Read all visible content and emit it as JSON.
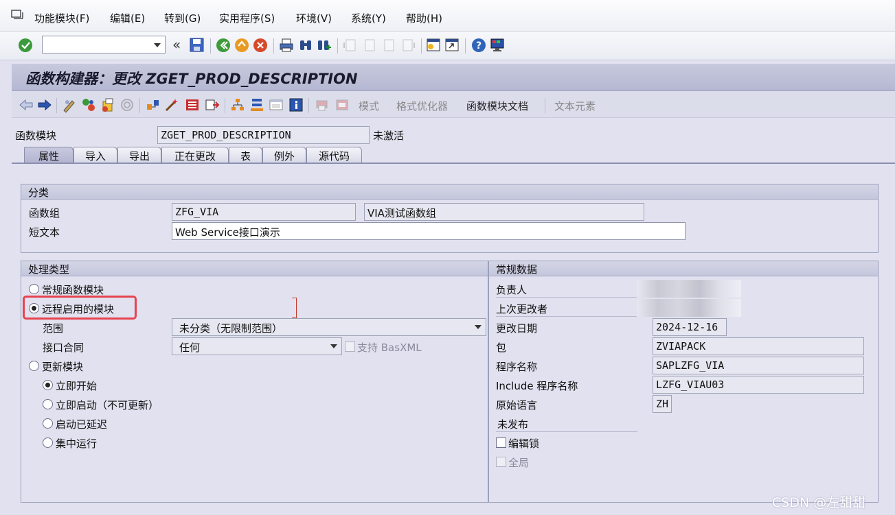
{
  "menu": {
    "items": [
      "功能模块(F)",
      "编辑(E)",
      "转到(G)",
      "实用程序(S)",
      "环境(V)",
      "系统(Y)",
      "帮助(H)"
    ]
  },
  "system_toolbar": {
    "command_field_value": ""
  },
  "title": "函数构建器：更改 ZGET_PROD_DESCRIPTION",
  "app_toolbar": {
    "pattern": "模式",
    "pretty_printer": "格式优化器",
    "fm_doc": "函数模块文档",
    "text_elements": "文本元素"
  },
  "header": {
    "fm_label": "函数模块",
    "fm_value": "ZGET_PROD_DESCRIPTION",
    "status": "未激活"
  },
  "tabs": [
    "属性",
    "导入",
    "导出",
    "正在更改",
    "表",
    "例外",
    "源代码"
  ],
  "classification": {
    "title": "分类",
    "group_label": "函数组",
    "group_value": "ZFG_VIA",
    "group_desc": "VIA测试函数组",
    "short_text_label": "短文本",
    "short_text_value": "Web Service接口演示"
  },
  "processing": {
    "title": "处理类型",
    "normal": "常规函数模块",
    "remote": "远程启用的模块",
    "scope_label": "范围",
    "scope_value": "未分类（无限制范围）",
    "interface_label": "接口合同",
    "interface_value": "任何",
    "basxml": "支持 BasXML",
    "update": "更新模块",
    "start_immediately": "立即开始",
    "start_immediately_nu": "立即启动（不可更新）",
    "start_delayed": "启动已延迟",
    "collective_run": "集中运行"
  },
  "general": {
    "title": "常规数据",
    "owner_label": "负责人",
    "last_changed_by_label": "上次更改者",
    "changed_on_label": "更改日期",
    "changed_on_value": "2024-12-16",
    "package_label": "包",
    "package_value": "ZVIAPACK",
    "program_label": "程序名称",
    "program_value": "SAPLZFG_VIA",
    "include_label": "Include 程序名称",
    "include_value": "LZFG_VIAU03",
    "language_label": "原始语言",
    "language_value": "ZH",
    "not_released": "未发布",
    "edit_lock": "编辑锁",
    "global": "全局"
  },
  "watermark": "CSDN @左甜甜",
  "colors": {
    "highlight": "#e8424f",
    "title_band": "#b5b8d2",
    "background": "#e1e1ef"
  }
}
